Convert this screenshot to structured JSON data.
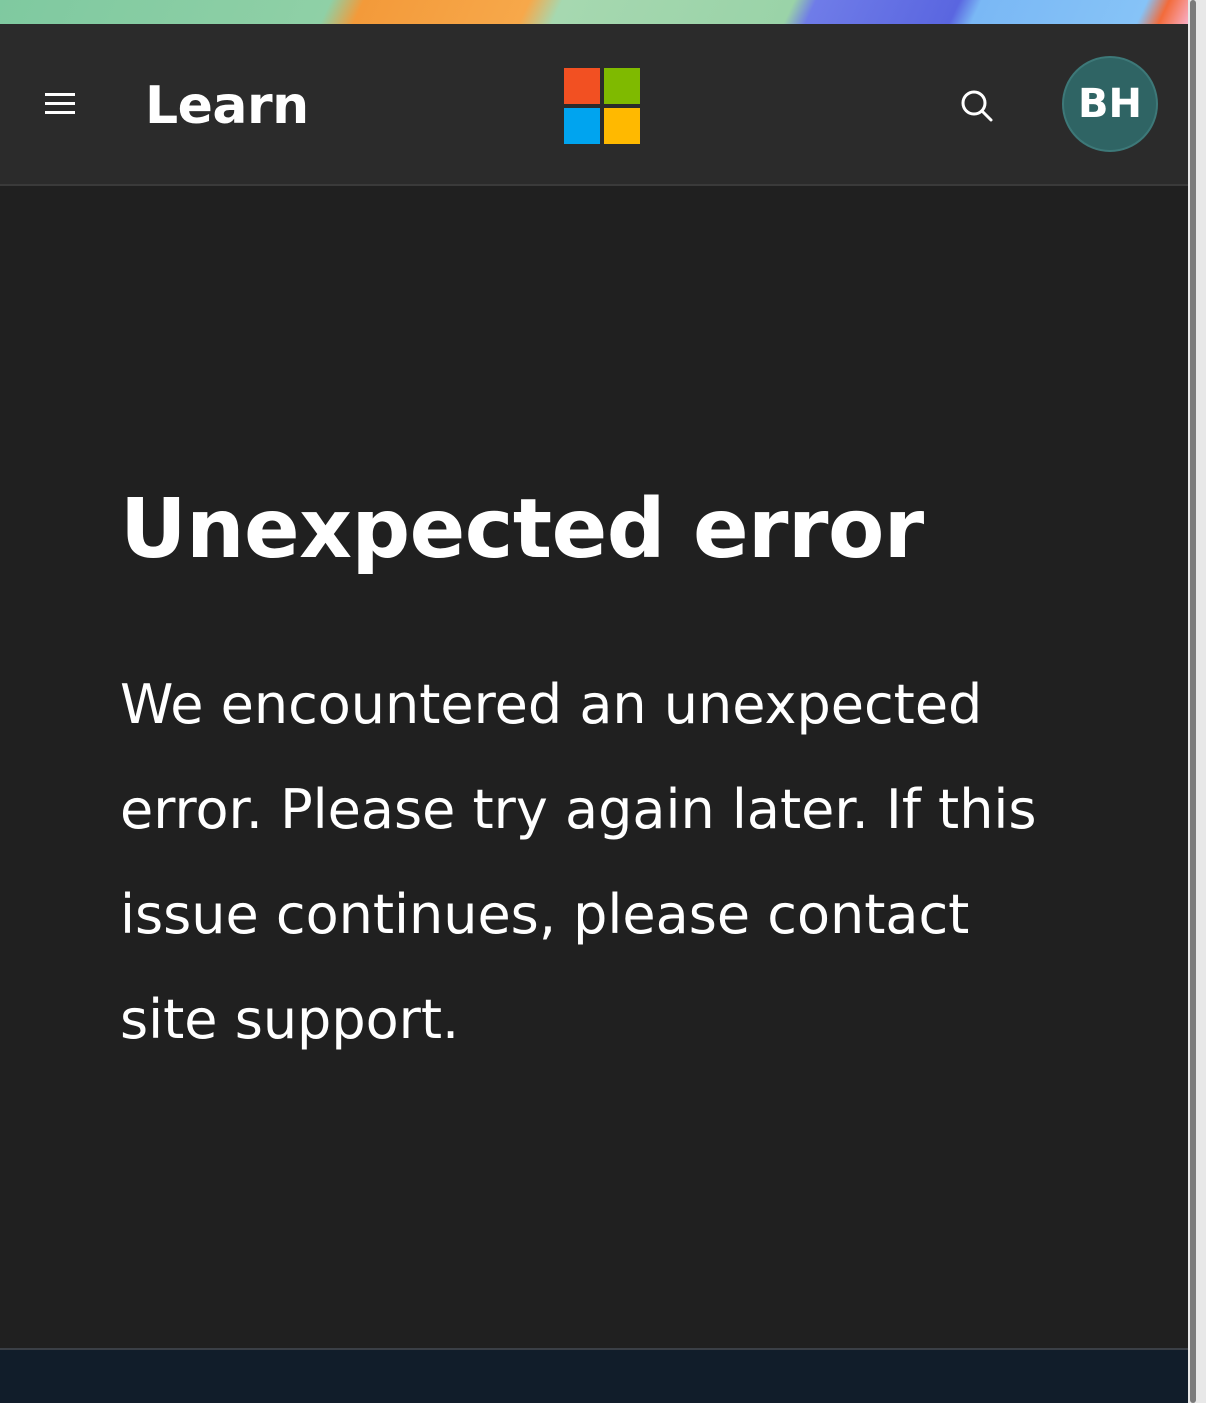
{
  "header": {
    "menu_icon": "hamburger-menu-icon",
    "brand": "Learn",
    "logo": {
      "name": "microsoft-logo",
      "colors": [
        "#f25022",
        "#7fba00",
        "#00a4ef",
        "#ffb900"
      ]
    },
    "search_icon": "search-icon",
    "avatar_initials": "BH",
    "avatar_color": "#2f6464"
  },
  "main": {
    "title": "Unexpected error",
    "message": "We encountered an unexpected error. Please try again later. If this issue continues, please contact site support."
  },
  "colors": {
    "background": "#202020",
    "topbar": "#2b2b2b",
    "text": "#ffffff",
    "footer": "#111d2a"
  }
}
